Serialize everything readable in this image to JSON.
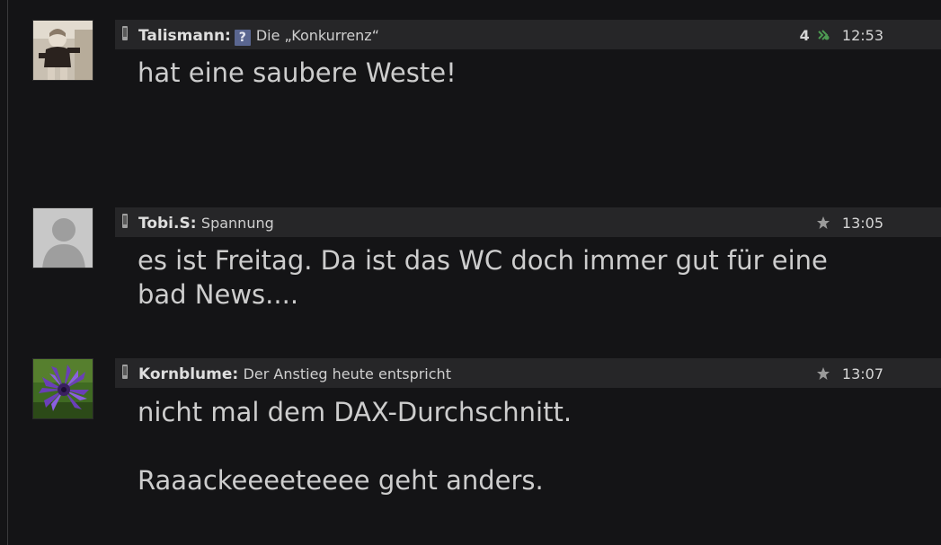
{
  "posts": [
    {
      "avatar": "child-photo-avatar",
      "username": "Talismann:",
      "badge_icon": "question-mark-icon",
      "badge_label": "?",
      "subject": "Die „Konkurrenz“",
      "votes": "4",
      "meta_icon": "recommend-icon",
      "time": "12:53",
      "body": "hat eine saubere Weste!"
    },
    {
      "avatar": "default-avatar",
      "username": "Tobi.S:",
      "subject": "Spannung",
      "votes": "",
      "meta_icon": "star-icon",
      "time": "13:05",
      "body": "es ist Freitag. Da ist das WC doch immer gut für eine bad News...."
    },
    {
      "avatar": "cornflower-avatar",
      "username": "Kornblume:",
      "subject": "Der Anstieg heute entspricht",
      "votes": "",
      "meta_icon": "star-icon",
      "time": "13:07",
      "body": "nicht mal dem DAX-Durchschnitt.\n\nRaaackeeeeteeee geht anders."
    }
  ],
  "colors": {
    "background": "#141416",
    "header_bar": "#262628",
    "text": "#cdcdcd",
    "recommend_icon": "#4d9a52",
    "star_icon": "#9a9a9a",
    "badge": "#5a6690"
  }
}
